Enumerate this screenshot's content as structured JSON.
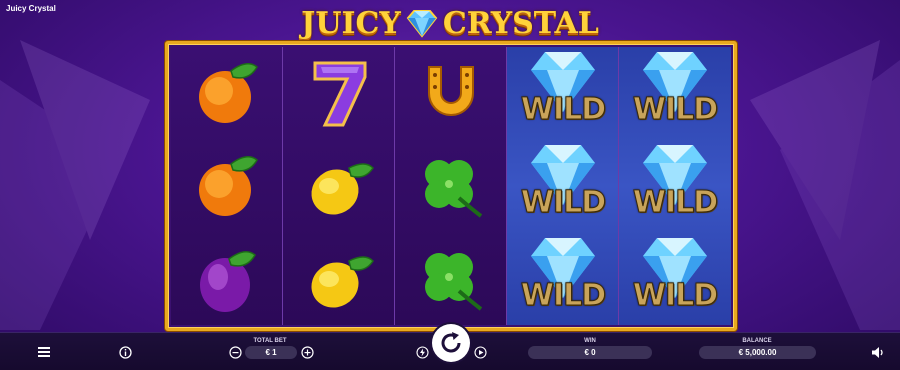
{
  "window": {
    "title": "Juicy Crystal"
  },
  "logo": {
    "word_left": "JUICY",
    "word_right": "CRYSTAL"
  },
  "reels": [
    [
      "orange-icon",
      "orange-icon",
      "plum-icon"
    ],
    [
      "seven-icon",
      "lemon-icon",
      "lemon-icon"
    ],
    [
      "horseshoe-icon",
      "clover-icon",
      "clover-icon"
    ],
    [
      "diamond-wild-icon",
      "diamond-wild-icon",
      "diamond-wild-icon"
    ],
    [
      "diamond-wild-icon",
      "diamond-wild-icon",
      "diamond-wild-icon"
    ]
  ],
  "wild_label": "WILD",
  "controls": {
    "menu_icon": "menu-icon",
    "info_icon": "info-icon",
    "total_bet_label": "TOTAL BET",
    "total_bet_value": "€ 1",
    "win_label": "WIN",
    "win_value": "€ 0",
    "balance_label": "BALANCE",
    "balance_value": "€ 5,000.00",
    "sound_icon": "speaker-icon"
  },
  "colors": {
    "background": "#4a1590",
    "frame_gold": "#e9a91f",
    "wild_reel": "#3a55c4",
    "bar": "#1d0f3a"
  }
}
